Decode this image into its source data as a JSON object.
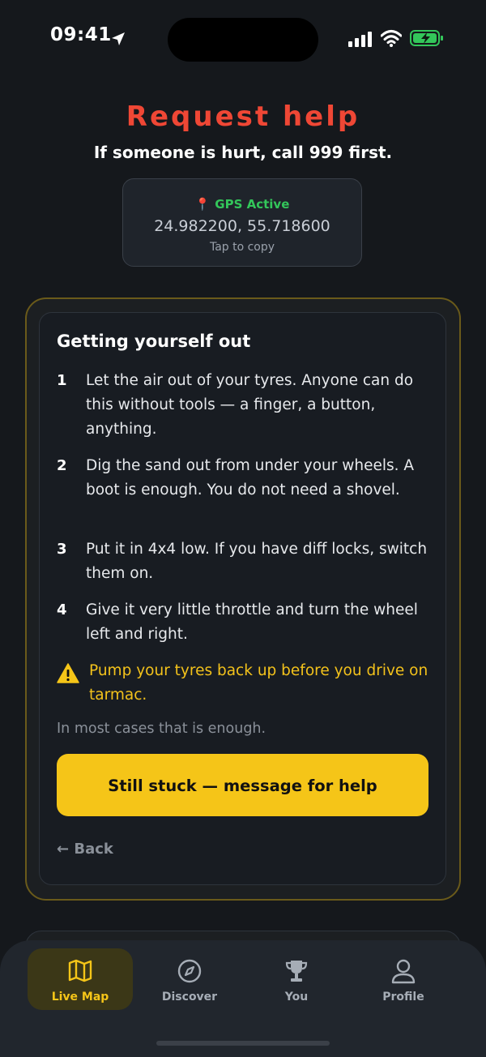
{
  "status_bar": {
    "time": "09:41"
  },
  "header": {
    "title": "Request help",
    "subtitle": "If someone is hurt, call 999 first."
  },
  "gps": {
    "status": "GPS Active",
    "coords": "24.982200, 55.718600",
    "hint": "Tap to copy",
    "status_color": "#33c65a"
  },
  "guide": {
    "title": "Getting yourself out",
    "steps": [
      {
        "num": "1",
        "text": "Let the air out of your tyres. Anyone can do this without tools — a finger, a button, anything."
      },
      {
        "num": "2",
        "text": "Dig the sand out from under your wheels. A boot is enough. You do not need a shovel."
      },
      {
        "num": "3",
        "text": "Put it in 4x4 low. If you have diff locks, switch them on."
      },
      {
        "num": "4",
        "text": "Give it very little throttle and turn the wheel left and right."
      }
    ],
    "warning": "Pump your tyres back up before you drive on tarmac.",
    "note": "In most cases that is enough.",
    "cta_label": "Still stuck — message for help",
    "back_label": "← Back"
  },
  "tabbar": {
    "tabs": [
      {
        "label": "Live Map",
        "icon": "map-icon",
        "active": true
      },
      {
        "label": "Discover",
        "icon": "compass-icon",
        "active": false
      },
      {
        "label": "You",
        "icon": "trophy-icon",
        "active": false
      },
      {
        "label": "Profile",
        "icon": "user-icon",
        "active": false
      }
    ]
  },
  "colors": {
    "accent": "#f5c518",
    "title_red": "#ef4735",
    "background": "#15181c"
  }
}
